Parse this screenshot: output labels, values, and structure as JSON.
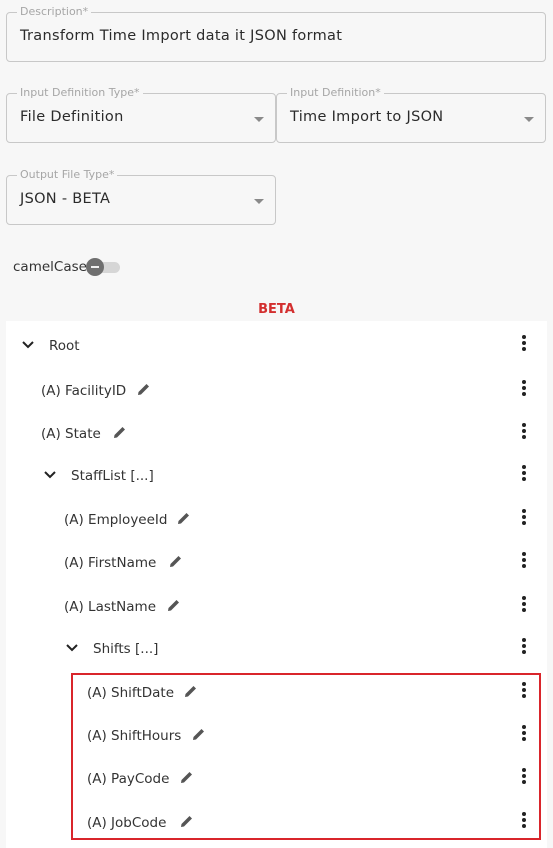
{
  "description": {
    "label": "Description*",
    "value": "Transform Time Import data it JSON format"
  },
  "input_definition_type": {
    "label": "Input Definition Type*",
    "value": "File Definition"
  },
  "input_definition": {
    "label": "Input Definition*",
    "value": "Time Import to JSON"
  },
  "output_file_type": {
    "label": "Output File Type*",
    "value": "JSON - BETA"
  },
  "camel_case": {
    "label": "camelCase",
    "enabled": false
  },
  "beta_label": "BETA",
  "tree": {
    "root": "Root",
    "facility_id": "(A) FacilityID",
    "state": "(A) State",
    "staff_list": "StaffList [...]",
    "employee_id": "(A) EmployeeId",
    "first_name": "(A) FirstName",
    "last_name": "(A) LastName",
    "shifts": "Shifts [...]",
    "shift_date": "(A) ShiftDate",
    "shift_hours": "(A) ShiftHours",
    "pay_code": "(A) PayCode",
    "job_code": "(A) JobCode"
  },
  "icons": [
    "chevron-down-icon",
    "pencil-icon",
    "more-vert-icon",
    "dropdown-caret-icon"
  ],
  "colors": {
    "beta": "#d32f2f",
    "highlight": "#d9252b"
  }
}
